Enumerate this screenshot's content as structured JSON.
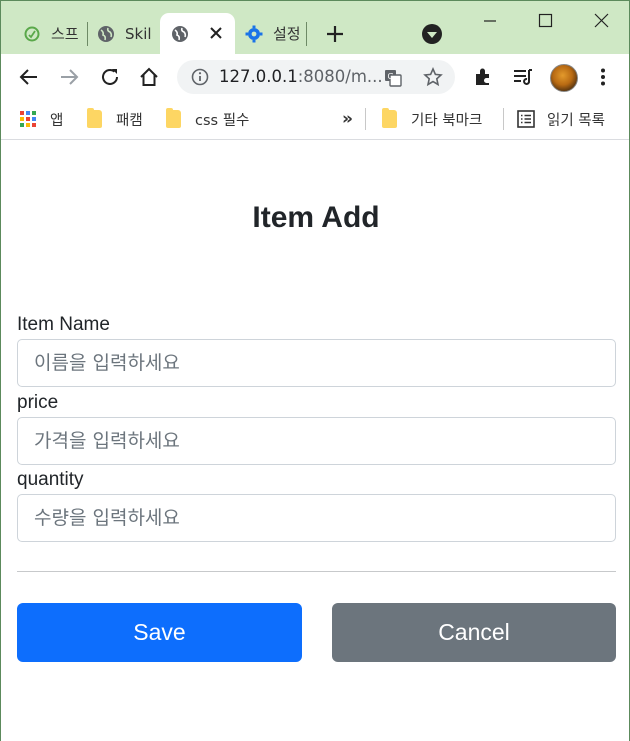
{
  "browser": {
    "tabs": [
      {
        "title": "스프",
        "icon": "spring-leaf-icon",
        "active": false
      },
      {
        "title": "Skil",
        "icon": "globe-icon",
        "active": false
      },
      {
        "title": "",
        "icon": "globe-icon",
        "active": true
      },
      {
        "title": "설정",
        "icon": "gear-icon",
        "active": false
      }
    ],
    "address": {
      "host": "127.0.0.1",
      "rest": ":8080/m..."
    },
    "bookmarks": {
      "apps": "앱",
      "folder1": "패캠",
      "folder2": "css 필수",
      "more": "»",
      "other": "기타 북마크",
      "reading_list": "읽기 목록"
    }
  },
  "page": {
    "title": "Item Add",
    "fields": {
      "item_name": {
        "label": "Item Name",
        "placeholder": "이름을 입력하세요",
        "value": ""
      },
      "price": {
        "label": "price",
        "placeholder": "가격을 입력하세요",
        "value": ""
      },
      "quantity": {
        "label": "quantity",
        "placeholder": "수량을 입력하세요",
        "value": ""
      }
    },
    "buttons": {
      "save": "Save",
      "cancel": "Cancel"
    }
  },
  "colors": {
    "primary": "#0d6efd",
    "secondary": "#6c757d",
    "tabstrip": "#cfe8c5"
  }
}
